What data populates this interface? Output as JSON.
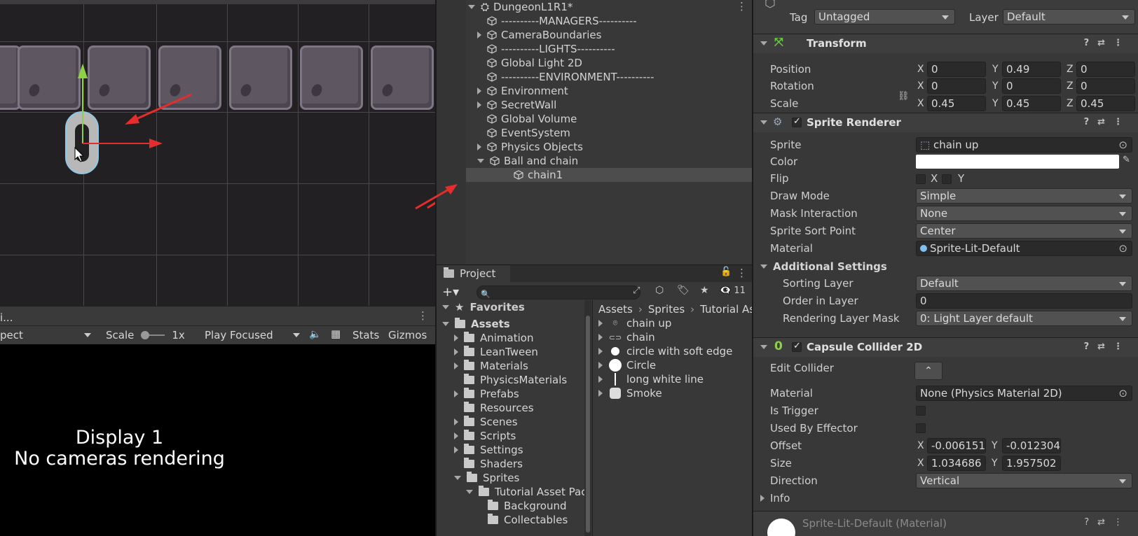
{
  "hierarchy": {
    "scene_name": "DungeonL1R1*",
    "items": [
      {
        "label": "----------MANAGERS----------",
        "indent": 0,
        "arrow": "none"
      },
      {
        "label": "CameraBoundaries",
        "indent": 0,
        "arrow": "right"
      },
      {
        "label": "----------LIGHTS----------",
        "indent": 0,
        "arrow": "none"
      },
      {
        "label": "Global Light 2D",
        "indent": 0,
        "arrow": "none"
      },
      {
        "label": "----------ENVIRONMENT----------",
        "indent": 0,
        "arrow": "none"
      },
      {
        "label": "Environment",
        "indent": 0,
        "arrow": "right"
      },
      {
        "label": "SecretWall",
        "indent": 0,
        "arrow": "right"
      },
      {
        "label": "Global Volume",
        "indent": 0,
        "arrow": "none"
      },
      {
        "label": "EventSystem",
        "indent": 0,
        "arrow": "none"
      },
      {
        "label": "Physics Objects",
        "indent": 0,
        "arrow": "right"
      },
      {
        "label": "Ball and chain",
        "indent": 0,
        "arrow": "down"
      },
      {
        "label": "chain1",
        "indent": 1,
        "arrow": "none",
        "selected": true
      }
    ]
  },
  "game_toolbar": {
    "tab_label": "i...",
    "aspect": "pect",
    "scale_label": "Scale",
    "scale_value": "1x",
    "play_focused": "Play Focused",
    "stats": "Stats",
    "gizmos": "Gizmos"
  },
  "game_view": {
    "display": "Display 1",
    "message": "No cameras rendering"
  },
  "project": {
    "tab_label": "Project",
    "search_placeholder": "",
    "hidden_count": "11",
    "favorites": "Favorites",
    "assets_root": "Assets",
    "folders": [
      {
        "label": "Animation",
        "depth": 1,
        "open": false
      },
      {
        "label": "LeanTween",
        "depth": 1,
        "open": false
      },
      {
        "label": "Materials",
        "depth": 1,
        "open": false
      },
      {
        "label": "PhysicsMaterials",
        "depth": 1,
        "open": false,
        "noarrow": true
      },
      {
        "label": "Prefabs",
        "depth": 1,
        "open": false
      },
      {
        "label": "Resources",
        "depth": 1,
        "open": false,
        "noarrow": true
      },
      {
        "label": "Scenes",
        "depth": 1,
        "open": false
      },
      {
        "label": "Scripts",
        "depth": 1,
        "open": false
      },
      {
        "label": "Settings",
        "depth": 1,
        "open": false
      },
      {
        "label": "Shaders",
        "depth": 1,
        "open": false,
        "noarrow": true
      },
      {
        "label": "Sprites",
        "depth": 1,
        "open": true
      },
      {
        "label": "Tutorial Asset Pac",
        "depth": 2,
        "open": true
      },
      {
        "label": "Background",
        "depth": 3,
        "open": false,
        "noarrow": true
      },
      {
        "label": "Collectables",
        "depth": 3,
        "open": false,
        "noarrow": true
      }
    ],
    "breadcrumb": [
      "Assets",
      "Sprites",
      "Tutorial As"
    ],
    "files": [
      {
        "label": "chain up",
        "icon": "chain-up-icon"
      },
      {
        "label": "chain",
        "icon": "chain-icon"
      },
      {
        "label": "circle with soft edge",
        "icon": "circle-small-icon"
      },
      {
        "label": "Circle",
        "icon": "circle-icon"
      },
      {
        "label": "long white line",
        "icon": "line-icon"
      },
      {
        "label": "Smoke",
        "icon": "smoke-icon"
      }
    ]
  },
  "inspector": {
    "tag_label": "Tag",
    "tag_value": "Untagged",
    "layer_label": "Layer",
    "layer_value": "Default",
    "transform": {
      "title": "Transform",
      "position_label": "Position",
      "rotation_label": "Rotation",
      "scale_label": "Scale",
      "position": {
        "x": "0",
        "y": "0.49",
        "z": "0"
      },
      "rotation": {
        "x": "0",
        "y": "0",
        "z": "0"
      },
      "scale": {
        "x": "0.45",
        "y": "0.45",
        "z": "0.45"
      }
    },
    "sprite_renderer": {
      "title": "Sprite Renderer",
      "sprite_label": "Sprite",
      "sprite_value": "chain up",
      "color_label": "Color",
      "flip_label": "Flip",
      "flip_x": "X",
      "flip_y": "Y",
      "draw_mode_label": "Draw Mode",
      "draw_mode": "Simple",
      "mask_label": "Mask Interaction",
      "mask": "None",
      "sort_point_label": "Sprite Sort Point",
      "sort_point": "Center",
      "material_label": "Material",
      "material": "Sprite-Lit-Default",
      "additional": "Additional Settings",
      "sorting_layer_label": "Sorting Layer",
      "sorting_layer": "Default",
      "order_label": "Order in Layer",
      "order": "0",
      "rlm_label": "Rendering Layer Mask",
      "rlm": "0: Light Layer default"
    },
    "capsule": {
      "title": "Capsule Collider 2D",
      "edit_label": "Edit Collider",
      "material_label": "Material",
      "material": "None (Physics Material 2D)",
      "trigger_label": "Is Trigger",
      "effector_label": "Used By Effector",
      "offset_label": "Offset",
      "offset_x": "-0.006151",
      "offset_y": "-0.012304",
      "size_label": "Size",
      "size_x": "1.034686",
      "size_y": "1.957502",
      "direction_label": "Direction",
      "direction": "Vertical",
      "info_label": "Info"
    },
    "material_footer": "Sprite-Lit-Default (Material)"
  },
  "colors": {
    "selection": "#4d4d4d",
    "arrow_red": "#e42d2d",
    "gizmo_green": "#8fd144"
  }
}
